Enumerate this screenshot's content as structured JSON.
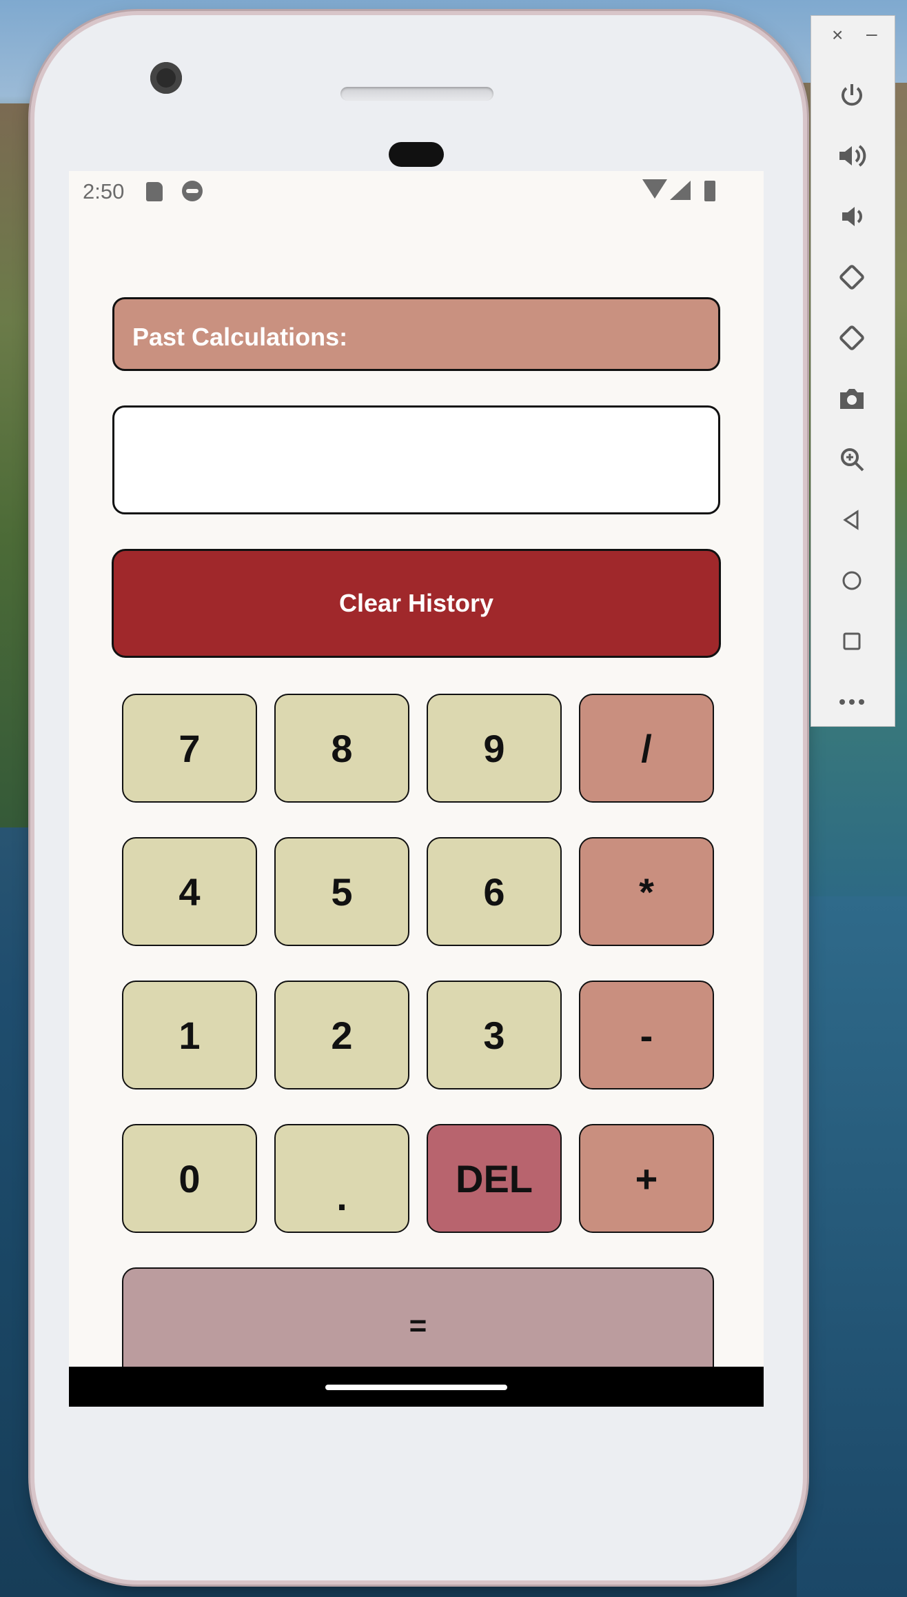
{
  "status_bar": {
    "time": "2:50"
  },
  "calculator": {
    "history_title": "Past Calculations:",
    "history_content": "",
    "clear_button": "Clear History",
    "keys": {
      "k7": "7",
      "k8": "8",
      "k9": "9",
      "divide": "/",
      "k4": "4",
      "k5": "5",
      "k6": "6",
      "multiply": "*",
      "k1": "1",
      "k2": "2",
      "k3": "3",
      "minus": "-",
      "k0": "0",
      "dot": ".",
      "del": "DEL",
      "plus": "+",
      "equals": "="
    }
  },
  "emulator_sidebar": {
    "close": "×",
    "minimize": "–",
    "buttons": [
      "power-icon",
      "volume-up-icon",
      "volume-down-icon",
      "rotate-left-icon",
      "rotate-right-icon",
      "camera-icon",
      "zoom-icon",
      "back-icon",
      "home-icon",
      "overview-icon",
      "more-icon"
    ]
  },
  "colors": {
    "past_header": "#c99180",
    "clear_button": "#a0282b",
    "number_key": "#dcd8b0",
    "operator_key": "#c98f7f",
    "delete_key": "#b8646e",
    "equals_key": "#bb9c9e"
  }
}
